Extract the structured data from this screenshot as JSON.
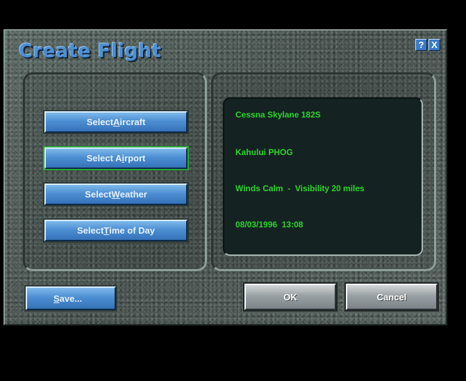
{
  "window": {
    "title": "Create Flight",
    "help_label": "?",
    "close_label": "X"
  },
  "menu": {
    "items": [
      {
        "before": "Select ",
        "key": "A",
        "after": "ircraft"
      },
      {
        "before": "Select A",
        "key": "i",
        "after": "rport"
      },
      {
        "before": "Select ",
        "key": "W",
        "after": "eather"
      },
      {
        "before": "Select ",
        "key": "T",
        "after": "ime of Day"
      }
    ]
  },
  "info": {
    "aircraft": "Cessna Skylane 182S",
    "airport": "Kahului PHOG",
    "weather": "Winds Calm  -  Visibility 20 miles",
    "time": "08/03/1996  13:08"
  },
  "footer": {
    "save_key": "S",
    "save_rest": "ave...",
    "ok_label": "OK",
    "cancel_label": "Cancel"
  },
  "colors": {
    "title": "#4d8fd2",
    "info_text": "#2bd62b",
    "info_bg": "#142322",
    "button_blue": "#4d8fd3",
    "active_outline": "#2aa83a"
  }
}
